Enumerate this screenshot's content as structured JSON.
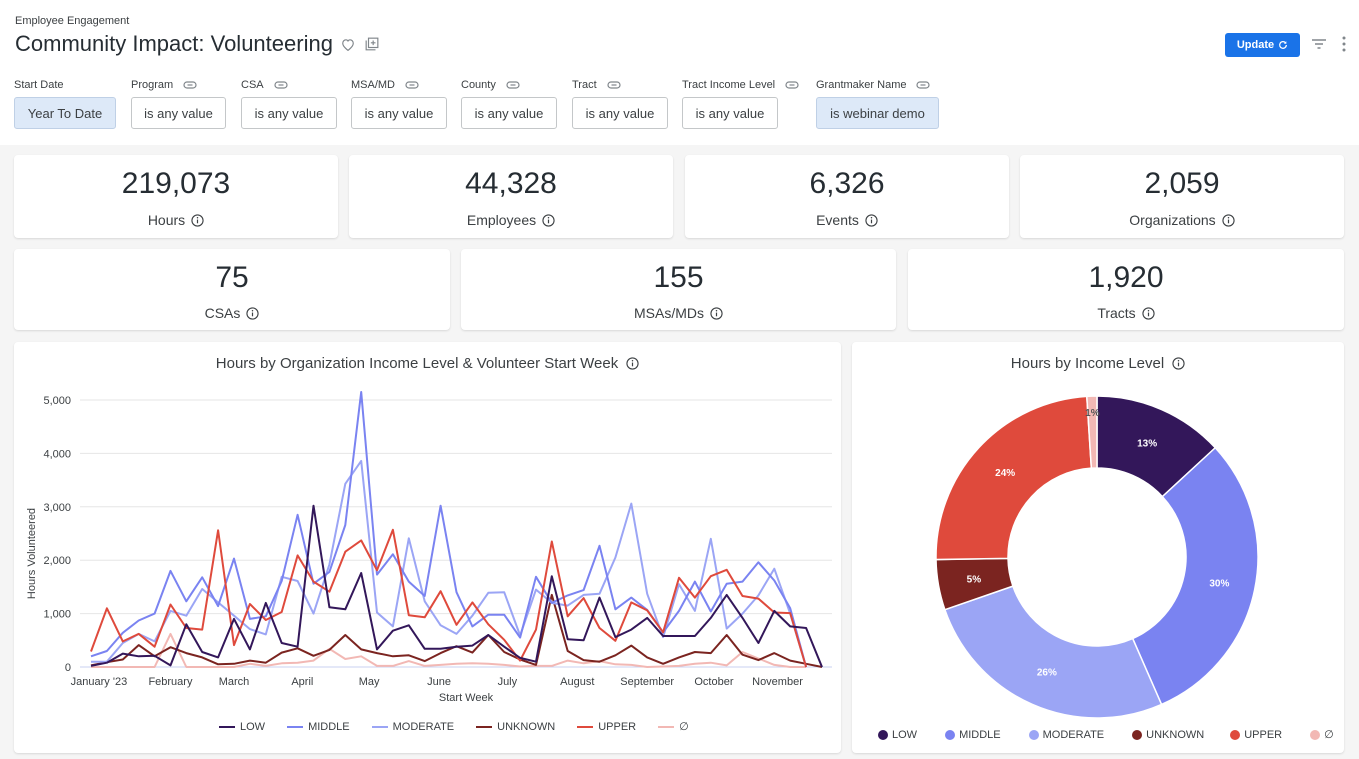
{
  "header": {
    "breadcrumb": "Employee Engagement",
    "title": "Community Impact: Volunteering",
    "update_label": "Update",
    "icons": [
      "heart-icon",
      "duplicate-icon",
      "refresh-icon",
      "filter-icon",
      "more-vert-icon"
    ]
  },
  "filters": [
    {
      "label": "Start Date",
      "value": "Year To Date",
      "active": true,
      "linked": false
    },
    {
      "label": "Program",
      "value": "is any value",
      "active": false,
      "linked": true
    },
    {
      "label": "CSA",
      "value": "is any value",
      "active": false,
      "linked": true
    },
    {
      "label": "MSA/MD",
      "value": "is any value",
      "active": false,
      "linked": true
    },
    {
      "label": "County",
      "value": "is any value",
      "active": false,
      "linked": true
    },
    {
      "label": "Tract",
      "value": "is any value",
      "active": false,
      "linked": true
    },
    {
      "label": "Tract Income Level",
      "value": "is any value",
      "active": false,
      "linked": true
    },
    {
      "label": "Grantmaker Name",
      "value": "is webinar demo",
      "active": true,
      "linked": true
    }
  ],
  "kpis_row1": [
    {
      "value": "219,073",
      "label": "Hours"
    },
    {
      "value": "44,328",
      "label": "Employees"
    },
    {
      "value": "6,326",
      "label": "Events"
    },
    {
      "value": "2,059",
      "label": "Organizations"
    }
  ],
  "kpis_row2": [
    {
      "value": "75",
      "label": "CSAs"
    },
    {
      "value": "155",
      "label": "MSAs/MDs"
    },
    {
      "value": "1,920",
      "label": "Tracts"
    }
  ],
  "colors": {
    "LOW": "#33175a",
    "MIDDLE": "#7a83f1",
    "MODERATE": "#9ba5f5",
    "UNKNOWN": "#7b2420",
    "UPPER": "#df4a3c",
    "NULL": "#f2b8b4",
    "accent": "#1a73e8"
  },
  "chart_data": [
    {
      "type": "line",
      "title": "Hours by Organization Income Level & Volunteer Start Week",
      "xlabel": "Start Week",
      "ylabel": "Hours Volunteered",
      "ylim": [
        0,
        5000
      ],
      "yticks": [
        0,
        1000,
        2000,
        3000,
        4000,
        5000
      ],
      "ytick_labels": [
        "0",
        "1,000",
        "2,000",
        "3,000",
        "4,000",
        "5,000"
      ],
      "xtick_labels": [
        "January '23",
        "February",
        "March",
        "April",
        "May",
        "June",
        "July",
        "August",
        "September",
        "October",
        "November"
      ],
      "xtick_weeks": [
        1.5,
        6,
        10,
        14.3,
        18.5,
        22.9,
        27.2,
        31.6,
        36,
        40.2,
        44.2
      ],
      "grid": true,
      "legend": "bottom",
      "n_weeks": 45,
      "series": [
        {
          "name": "LOW",
          "color": "#33175a",
          "values": [
            20,
            80,
            250,
            200,
            210,
            30,
            800,
            280,
            180,
            900,
            330,
            1200,
            450,
            380,
            3020,
            1120,
            1080,
            1760,
            330,
            680,
            780,
            340,
            340,
            380,
            400,
            600,
            380,
            170,
            100,
            1700,
            520,
            500,
            1300,
            560,
            700,
            920,
            580,
            580,
            580,
            920,
            1350,
            920,
            450,
            1050,
            760,
            730,
            0
          ]
        },
        {
          "name": "MIDDLE",
          "color": "#7a83f1",
          "values": [
            200,
            300,
            640,
            870,
            1000,
            1800,
            1230,
            1680,
            1140,
            2030,
            900,
            950,
            1610,
            2850,
            1560,
            1780,
            2660,
            5150,
            1730,
            2110,
            1600,
            1330,
            3020,
            1400,
            760,
            980,
            980,
            550,
            1690,
            1200,
            1340,
            1440,
            2270,
            1080,
            1300,
            1070,
            650,
            1050,
            1600,
            1040,
            1560,
            1600,
            1960,
            1620,
            1100,
            0
          ]
        },
        {
          "name": "MODERATE",
          "color": "#9ba5f5",
          "values": [
            100,
            100,
            450,
            620,
            480,
            1050,
            960,
            1460,
            1210,
            960,
            710,
            610,
            1690,
            1610,
            1000,
            1920,
            3430,
            3860,
            1020,
            760,
            2410,
            1230,
            780,
            620,
            960,
            1390,
            1400,
            590,
            1450,
            1200,
            1150,
            1350,
            1370,
            2050,
            3060,
            1370,
            560,
            1550,
            1050,
            2400,
            720,
            1000,
            1340,
            1840,
            1000,
            0
          ]
        },
        {
          "name": "UNKNOWN",
          "color": "#7b2420",
          "values": [
            30,
            90,
            140,
            410,
            200,
            370,
            260,
            180,
            50,
            60,
            120,
            80,
            270,
            350,
            210,
            320,
            600,
            330,
            260,
            200,
            220,
            110,
            260,
            390,
            270,
            600,
            280,
            140,
            40,
            1350,
            300,
            130,
            100,
            220,
            400,
            180,
            60,
            180,
            280,
            260,
            600,
            230,
            130,
            260,
            120,
            60,
            0
          ]
        },
        {
          "name": "UPPER",
          "color": "#df4a3c",
          "values": [
            290,
            1100,
            480,
            620,
            380,
            1170,
            730,
            700,
            2560,
            410,
            1180,
            880,
            1030,
            2090,
            1600,
            1410,
            2160,
            2370,
            1810,
            2570,
            970,
            930,
            1420,
            790,
            1210,
            800,
            510,
            120,
            700,
            2350,
            950,
            1290,
            730,
            490,
            1210,
            1060,
            650,
            1670,
            1300,
            1700,
            1820,
            1330,
            1280,
            1020,
            1010,
            0
          ]
        },
        {
          "name": "∅",
          "color": "#f2b8b4",
          "values": [
            0,
            0,
            0,
            0,
            0,
            620,
            0,
            0,
            0,
            0,
            60,
            20,
            70,
            80,
            120,
            340,
            150,
            200,
            20,
            20,
            110,
            20,
            40,
            60,
            70,
            60,
            40,
            10,
            20,
            20,
            120,
            70,
            110,
            50,
            40,
            0,
            10,
            20,
            60,
            80,
            30,
            280,
            160,
            40,
            0,
            0
          ]
        }
      ]
    },
    {
      "type": "pie",
      "title": "Hours by Income Level",
      "donut": true,
      "legend": "bottom",
      "categories": [
        "LOW",
        "MIDDLE",
        "MODERATE",
        "UNKNOWN",
        "UPPER",
        "∅"
      ],
      "values": [
        13,
        30,
        26,
        5,
        24,
        1
      ],
      "labels": [
        "13%",
        "30%",
        "26%",
        "5%",
        "24%",
        "1%"
      ],
      "colors": [
        "#33175a",
        "#7a83f1",
        "#9ba5f5",
        "#7b2420",
        "#df4a3c",
        "#f2b8b4"
      ]
    }
  ]
}
